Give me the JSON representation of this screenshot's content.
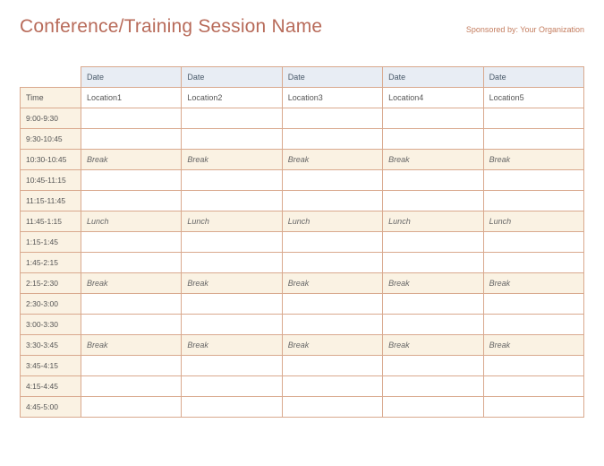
{
  "header": {
    "title": "Conference/Training Session Name",
    "sponsor": "Sponsored by: Your Organization"
  },
  "columns": {
    "time_label": "Time",
    "dates": [
      "Date",
      "Date",
      "Date",
      "Date",
      "Date"
    ],
    "locations": [
      "Location1",
      "Location2",
      "Location3",
      "Location4",
      "Location5"
    ]
  },
  "rows": [
    {
      "time": "9:00-9:30",
      "cells": [
        "",
        "",
        "",
        "",
        ""
      ],
      "highlight": false
    },
    {
      "time": "9:30-10:45",
      "cells": [
        "",
        "",
        "",
        "",
        ""
      ],
      "highlight": false
    },
    {
      "time": "10:30-10:45",
      "cells": [
        "Break",
        "Break",
        "Break",
        "Break",
        "Break"
      ],
      "highlight": true
    },
    {
      "time": "10:45-11:15",
      "cells": [
        "",
        "",
        "",
        "",
        ""
      ],
      "highlight": false
    },
    {
      "time": "11:15-11:45",
      "cells": [
        "",
        "",
        "",
        "",
        ""
      ],
      "highlight": false
    },
    {
      "time": "11:45-1:15",
      "cells": [
        "Lunch",
        "Lunch",
        "Lunch",
        "Lunch",
        "Lunch"
      ],
      "highlight": true
    },
    {
      "time": "1:15-1:45",
      "cells": [
        "",
        "",
        "",
        "",
        ""
      ],
      "highlight": false
    },
    {
      "time": "1:45-2:15",
      "cells": [
        "",
        "",
        "",
        "",
        ""
      ],
      "highlight": false
    },
    {
      "time": "2:15-2:30",
      "cells": [
        "Break",
        "Break",
        "Break",
        "Break",
        "Break"
      ],
      "highlight": true
    },
    {
      "time": "2:30-3:00",
      "cells": [
        "",
        "",
        "",
        "",
        ""
      ],
      "highlight": false
    },
    {
      "time": "3:00-3:30",
      "cells": [
        "",
        "",
        "",
        "",
        ""
      ],
      "highlight": false
    },
    {
      "time": "3:30-3:45",
      "cells": [
        "Break",
        "Break",
        "Break",
        "Break",
        "Break"
      ],
      "highlight": true
    },
    {
      "time": "3:45-4:15",
      "cells": [
        "",
        "",
        "",
        "",
        ""
      ],
      "highlight": false
    },
    {
      "time": "4:15-4:45",
      "cells": [
        "",
        "",
        "",
        "",
        ""
      ],
      "highlight": false
    },
    {
      "time": "4:45-5:00",
      "cells": [
        "",
        "",
        "",
        "",
        ""
      ],
      "highlight": false
    }
  ]
}
